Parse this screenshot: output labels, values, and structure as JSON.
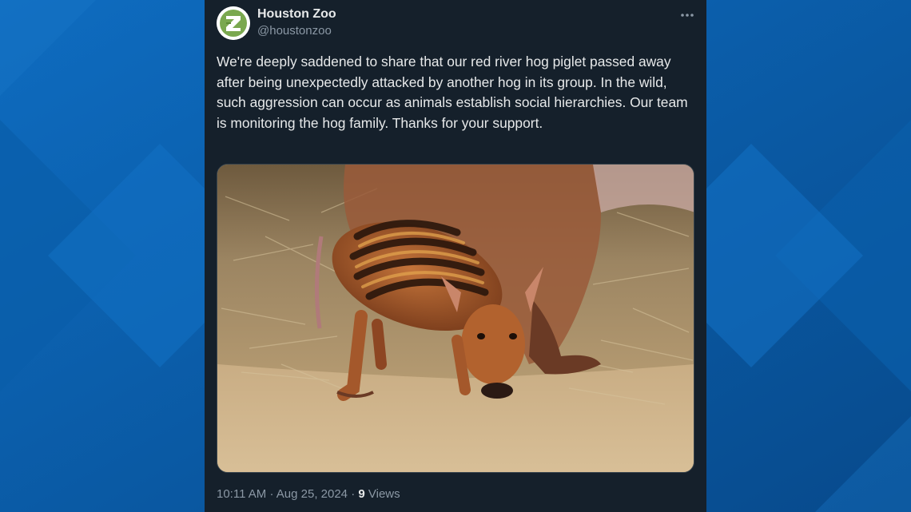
{
  "tweet": {
    "author": {
      "display_name": "Houston Zoo",
      "handle": "@houstonzoo",
      "avatar_icon": "houston-zoo-logo"
    },
    "more_icon": "more-horizontal-icon",
    "text": "We're deeply saddened to share that our red river hog piglet passed away after being unexpectedly attacked by another hog in its group. In the wild, such aggression can occur as animals establish social hierarchies. Our team is monitoring the hog family. Thanks for your support.",
    "time": "10:11 AM",
    "separator": "·",
    "date": "Aug 25, 2024",
    "views_count": "9",
    "views_label": "Views"
  },
  "colors": {
    "card_background": "#15202b",
    "text_primary": "#e7e9ea",
    "text_secondary": "#8b98a5",
    "page_background": "#0b5aa3",
    "logo_green": "#7aa84f"
  }
}
